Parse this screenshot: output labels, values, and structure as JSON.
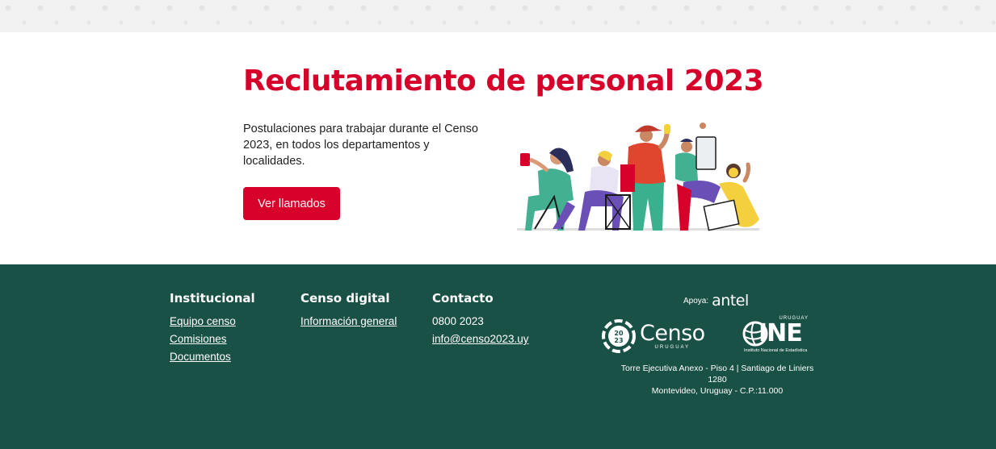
{
  "hero": {
    "title": "Reclutamiento de personal 2023",
    "description": "Postulaciones para trabajar durante el Censo 2023, en todos los departamentos y localidades.",
    "cta_label": "Ver llamados"
  },
  "footer": {
    "columns": [
      {
        "heading": "Institucional",
        "links": [
          "Equipo censo",
          "Comisiones",
          "Documentos"
        ]
      },
      {
        "heading": "Censo digital",
        "links": [
          "Información general"
        ]
      },
      {
        "heading": "Contacto",
        "phone": "0800 2023",
        "email": "info@censo2023.uy"
      }
    ],
    "supports_label": "Apoya:",
    "antel_logo": "antel",
    "censo_logo": {
      "word": "Censo",
      "sub": "URUGUAY",
      "badge_top": "20",
      "badge_bottom": "23"
    },
    "ine_logo": {
      "word": "INE",
      "top": "URUGUAY",
      "sub": "Instituto Nacional de Estadística"
    },
    "address_line1": "Torre Ejecutiva Anexo - Piso 4 | Santiago de Liniers 1280",
    "address_line2": "Montevideo, Uruguay - C.P.:11.000"
  },
  "colors": {
    "brand_red": "#d6002a",
    "footer_green": "#1a5146"
  }
}
